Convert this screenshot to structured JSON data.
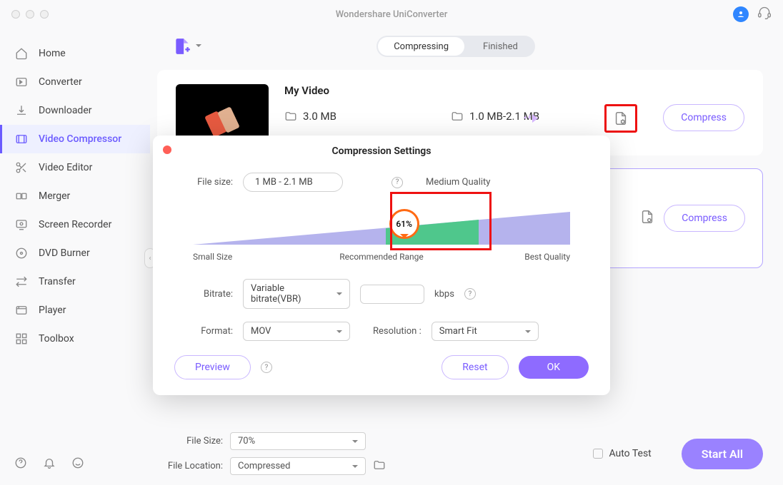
{
  "titlebar": {
    "title": "Wondershare UniConverter"
  },
  "sidebar": {
    "items": [
      {
        "label": "Home"
      },
      {
        "label": "Converter"
      },
      {
        "label": "Downloader"
      },
      {
        "label": "Video Compressor"
      },
      {
        "label": "Video Editor"
      },
      {
        "label": "Merger"
      },
      {
        "label": "Screen Recorder"
      },
      {
        "label": "DVD Burner"
      },
      {
        "label": "Transfer"
      },
      {
        "label": "Player"
      },
      {
        "label": "Toolbox"
      }
    ],
    "active_index": 3
  },
  "tabs": {
    "compressing": "Compressing",
    "finished": "Finished",
    "active": "compressing"
  },
  "card": {
    "title": "My Video",
    "source_size": "3.0 MB",
    "target_size": "1.0 MB-2.1 MB",
    "compress_label": "Compress"
  },
  "card2": {
    "compress_label": "Compress"
  },
  "modal": {
    "title": "Compression Settings",
    "file_size_label": "File size:",
    "file_size_value": "1 MB - 2.1 MB",
    "quality_text": "Medium Quality",
    "slider": {
      "percent": "61%",
      "left_label": "Small Size",
      "mid_label": "Recommended Range",
      "right_label": "Best Quality"
    },
    "bitrate_label": "Bitrate:",
    "bitrate_value": "Variable bitrate(VBR)",
    "bitrate_unit": "kbps",
    "format_label": "Format:",
    "format_value": "MOV",
    "resolution_label": "Resolution :",
    "resolution_value": "Smart Fit",
    "preview_label": "Preview",
    "reset_label": "Reset",
    "ok_label": "OK"
  },
  "bottom": {
    "file_size_label": "File Size:",
    "file_size_value": "70%",
    "file_location_label": "File Location:",
    "file_location_value": "Compressed",
    "auto_test_label": "Auto Test",
    "start_all_label": "Start All"
  }
}
